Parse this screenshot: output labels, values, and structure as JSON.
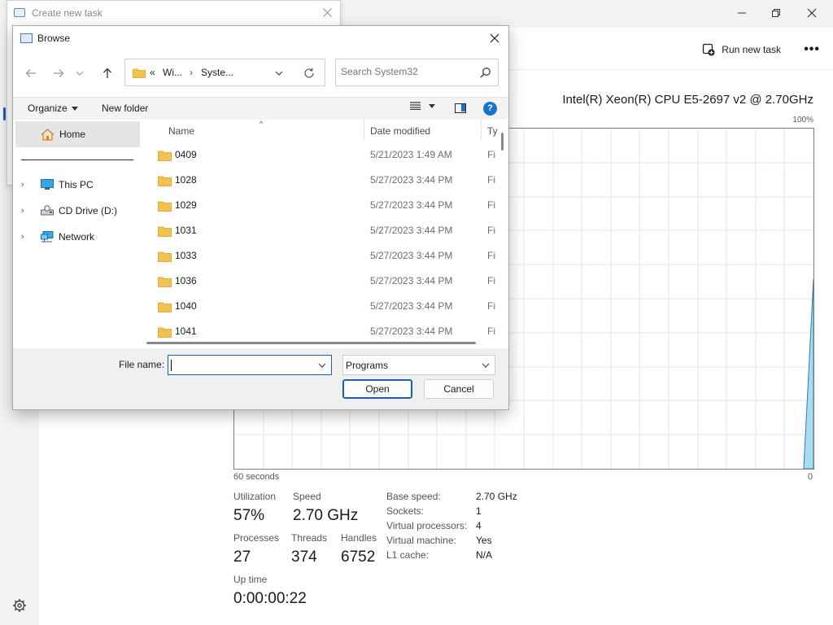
{
  "task_manager": {
    "run_new_task_label": "Run new task",
    "more_label": "•••",
    "cpu_name": "Intel(R) Xeon(R) CPU E5-2697 v2 @ 2.70GHz",
    "graph_max_label": "100%",
    "x_left_label": "60 seconds",
    "x_right_label": "0",
    "stats": {
      "utilization_label": "Utilization",
      "utilization_value": "57%",
      "speed_label": "Speed",
      "speed_value": "2.70 GHz",
      "processes_label": "Processes",
      "processes_value": "27",
      "threads_label": "Threads",
      "threads_value": "374",
      "handles_label": "Handles",
      "handles_value": "6752",
      "uptime_label": "Up time",
      "uptime_value": "0:00:00:22"
    },
    "specs": [
      {
        "label": "Base speed:",
        "value": "2.70 GHz"
      },
      {
        "label": "Sockets:",
        "value": "1"
      },
      {
        "label": "Virtual processors:",
        "value": "4"
      },
      {
        "label": "Virtual machine:",
        "value": "Yes"
      },
      {
        "label": "L1 cache:",
        "value": "N/A"
      }
    ]
  },
  "create_task_dialog": {
    "title": "Create new task"
  },
  "browse_dialog": {
    "title": "Browse",
    "address": {
      "overflow": "«",
      "crumb1": "Wi...",
      "crumb2": "Syste..."
    },
    "search_placeholder": "Search System32",
    "organize_label": "Organize",
    "new_folder_label": "New folder",
    "help_label": "?",
    "tree": {
      "home": "Home",
      "items": [
        {
          "label": "This PC"
        },
        {
          "label": "CD Drive (D:)"
        },
        {
          "label": "Network"
        }
      ]
    },
    "columns": {
      "name": "Name",
      "date": "Date modified",
      "type": "Ty"
    },
    "files": [
      {
        "name": "0409",
        "date": "5/21/2023 1:49 AM",
        "type": "Fi"
      },
      {
        "name": "1028",
        "date": "5/27/2023 3:44 PM",
        "type": "Fi"
      },
      {
        "name": "1029",
        "date": "5/27/2023 3:44 PM",
        "type": "Fi"
      },
      {
        "name": "1031",
        "date": "5/27/2023 3:44 PM",
        "type": "Fi"
      },
      {
        "name": "1033",
        "date": "5/27/2023 3:44 PM",
        "type": "Fi"
      },
      {
        "name": "1036",
        "date": "5/27/2023 3:44 PM",
        "type": "Fi"
      },
      {
        "name": "1040",
        "date": "5/27/2023 3:44 PM",
        "type": "Fi"
      },
      {
        "name": "1041",
        "date": "5/27/2023 3:44 PM",
        "type": "Fi"
      }
    ],
    "file_name_label": "File name:",
    "file_name_value": "",
    "file_type_value": "Programs",
    "open_label": "Open",
    "cancel_label": "Cancel"
  },
  "colors": {
    "accent": "#1a5fb4",
    "folder": "#f2c14e",
    "graph_fill": "#9fd7f0"
  }
}
